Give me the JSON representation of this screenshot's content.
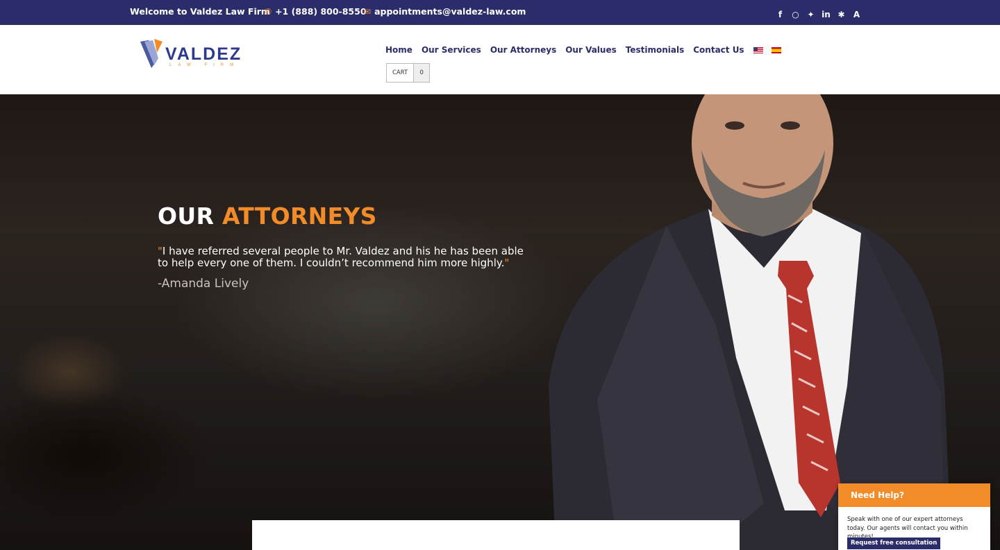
{
  "topbar": {
    "welcome": "Welcome to Valdez Law Firm",
    "phone": "+1 (888) 800-8550",
    "email": "appointments@valdez-law.com",
    "phone_icon": "phone-icon",
    "email_icon": "envelope-icon",
    "social": [
      "facebook-icon",
      "instagram-icon",
      "twitter-icon",
      "linkedin-icon",
      "yelp-icon",
      "avvo-icon"
    ]
  },
  "logo": {
    "word": "VALDEZ",
    "sub": "LAW FIRM"
  },
  "nav": {
    "items": [
      "Home",
      "Our Services",
      "Our Attorneys",
      "Our Values",
      "Testimonials",
      "Contact Us"
    ],
    "flags": [
      "us-flag-icon",
      "spain-flag-icon"
    ]
  },
  "cart": {
    "label": "CART",
    "count": "0"
  },
  "hero": {
    "title_white": "OUR ",
    "title_accent": "ATTORNEYS",
    "quote_open": "\"",
    "quote": "I have referred several people to Mr. Valdez and his he has been able to help every one of them. I couldn’t recommend him more highly.",
    "quote_close": "\"",
    "author": "-Amanda Lively"
  },
  "help": {
    "title": "Need Help?",
    "text": "Speak with one of our expert attorneys today. Our agents will contact you within minutes!",
    "button": "Request free consultation"
  },
  "colors": {
    "navy": "#2b2d6b",
    "orange": "#f28c28"
  }
}
